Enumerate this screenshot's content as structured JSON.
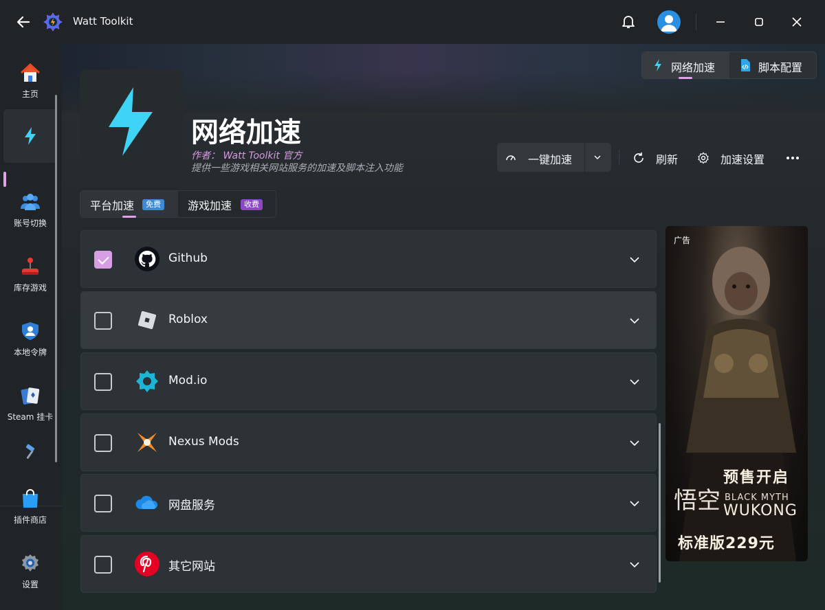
{
  "app": {
    "title": "Watt Toolkit"
  },
  "sidebar": {
    "items": [
      {
        "label": "主页",
        "icon": "home-icon"
      },
      {
        "label": "",
        "icon": "lightning-icon"
      },
      {
        "label": "账号切换",
        "icon": "users-icon"
      },
      {
        "label": "库存游戏",
        "icon": "joystick-icon"
      },
      {
        "label": "本地令牌",
        "icon": "shield-user-icon"
      },
      {
        "label": "Steam 挂卡",
        "icon": "cards-icon"
      },
      {
        "label": "",
        "icon": "hammer-icon"
      },
      {
        "label": "插件商店",
        "icon": "shopping-bag-icon"
      },
      {
        "label": "设置",
        "icon": "gear-icon"
      }
    ]
  },
  "top_tabs": [
    {
      "label": "网络加速",
      "icon": "lightning-icon"
    },
    {
      "label": "脚本配置",
      "icon": "script-icon"
    }
  ],
  "plugin": {
    "title": "网络加速",
    "author": "作者： Watt Toolkit 官方",
    "description": "提供一些游戏相关网站服务的加速及脚本注入功能"
  },
  "actions": {
    "accelerate": "一键加速",
    "refresh": "刷新",
    "settings": "加速设置"
  },
  "sub_tabs": [
    {
      "label": "平台加速",
      "badge": "免费"
    },
    {
      "label": "游戏加速",
      "badge": "收费"
    }
  ],
  "rows": [
    {
      "name": "Github",
      "checked": true,
      "icon": "github-icon"
    },
    {
      "name": "Roblox",
      "checked": false,
      "icon": "roblox-icon"
    },
    {
      "name": "Mod.io",
      "checked": false,
      "icon": "modio-icon"
    },
    {
      "name": "Nexus Mods",
      "checked": false,
      "icon": "nexus-mods-icon"
    },
    {
      "name": "网盘服务",
      "checked": false,
      "icon": "cloud-icon"
    },
    {
      "name": "其它网站",
      "checked": false,
      "icon": "pinterest-icon"
    }
  ],
  "ad": {
    "label": "广告",
    "line1": "预售开启",
    "brand_cn": "悟空",
    "brand_en_small": "BLACK MYTH",
    "brand_en_big": "WUKONG",
    "price": "标准版229元"
  },
  "colors": {
    "accent": "#e3a1ea",
    "bolt": "#3fd3f5",
    "free_badge": "#3f8ad8",
    "paid_badge": "#8d48c9"
  }
}
